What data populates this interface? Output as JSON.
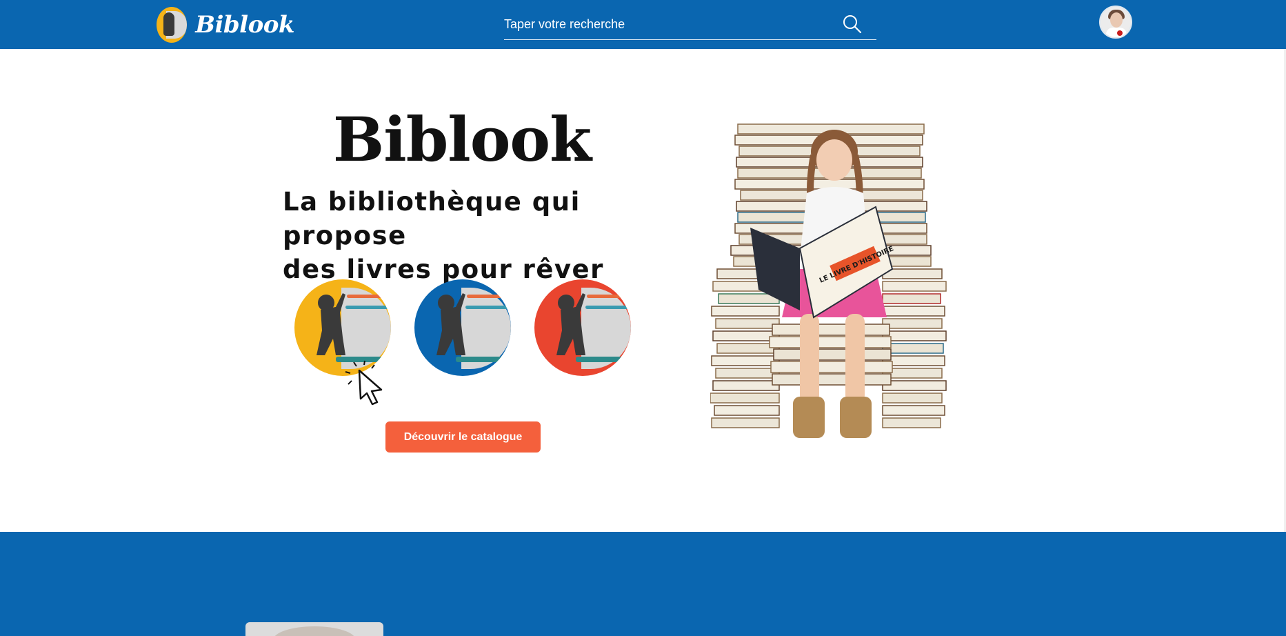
{
  "header": {
    "brand_name": "Biblook",
    "search_placeholder": "Taper votre recherche",
    "search_icon": "search-icon",
    "avatar_icon": "user-avatar"
  },
  "hero": {
    "title": "Biblook",
    "subtitle_line1": "La bibliothèque qui propose",
    "subtitle_line2": "des livres pour rêver",
    "cta_label": "Découvrir le catalogue",
    "categories": [
      {
        "name": "category-yellow",
        "color": "#f5b318"
      },
      {
        "name": "category-blue",
        "color": "#0a66b0"
      },
      {
        "name": "category-red",
        "color": "#e9452f"
      }
    ],
    "illustration": "girl-reading-on-book-stack",
    "illustration_book_text": "LE LIVRE D'HISTOIRE"
  },
  "colors": {
    "primary": "#0a66b0",
    "accent": "#f4603c",
    "yellow": "#f5b318",
    "red": "#e9452f"
  }
}
